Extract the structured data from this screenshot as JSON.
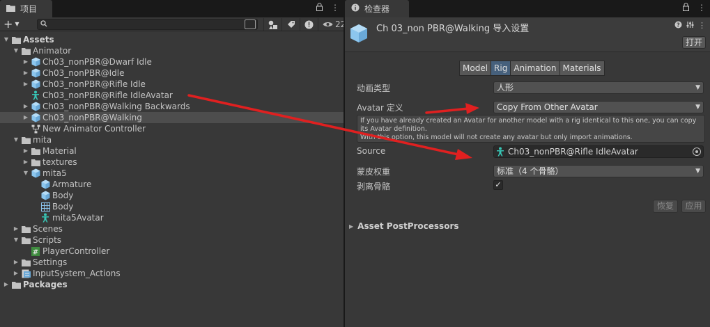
{
  "project_panel": {
    "tab_label": "项目",
    "search": {
      "value": "",
      "placeholder": ""
    },
    "visible_count": "22",
    "tree": [
      {
        "label": "Assets",
        "depth": 0,
        "arrow": "open",
        "icon": "folder",
        "bold": true
      },
      {
        "label": "Animator",
        "depth": 1,
        "arrow": "open",
        "icon": "folder"
      },
      {
        "label": "Ch03_nonPBR@Dwarf Idle",
        "depth": 2,
        "arrow": "closed",
        "icon": "model"
      },
      {
        "label": "Ch03_nonPBR@Idle",
        "depth": 2,
        "arrow": "closed",
        "icon": "model"
      },
      {
        "label": "Ch03_nonPBR@Rifle Idle",
        "depth": 2,
        "arrow": "closed",
        "icon": "model"
      },
      {
        "label": "Ch03_nonPBR@Rifle IdleAvatar",
        "depth": 2,
        "arrow": "none",
        "icon": "avatar"
      },
      {
        "label": "Ch03_nonPBR@Walking Backwards",
        "depth": 2,
        "arrow": "closed",
        "icon": "model"
      },
      {
        "label": "Ch03_nonPBR@Walking",
        "depth": 2,
        "arrow": "closed",
        "icon": "model",
        "selected": true
      },
      {
        "label": "New Animator Controller",
        "depth": 2,
        "arrow": "none",
        "icon": "controller"
      },
      {
        "label": "mita",
        "depth": 1,
        "arrow": "open",
        "icon": "folder"
      },
      {
        "label": "Material",
        "depth": 2,
        "arrow": "closed",
        "icon": "folder"
      },
      {
        "label": "textures",
        "depth": 2,
        "arrow": "closed",
        "icon": "folder"
      },
      {
        "label": "mita5",
        "depth": 2,
        "arrow": "open",
        "icon": "model"
      },
      {
        "label": "Armature",
        "depth": 3,
        "arrow": "none",
        "icon": "model"
      },
      {
        "label": "Body",
        "depth": 3,
        "arrow": "none",
        "icon": "model"
      },
      {
        "label": "Body",
        "depth": 3,
        "arrow": "none",
        "icon": "mesh"
      },
      {
        "label": "mita5Avatar",
        "depth": 3,
        "arrow": "none",
        "icon": "avatar"
      },
      {
        "label": "Scenes",
        "depth": 1,
        "arrow": "closed",
        "icon": "folder"
      },
      {
        "label": "Scripts",
        "depth": 1,
        "arrow": "open",
        "icon": "folder"
      },
      {
        "label": "PlayerController",
        "depth": 2,
        "arrow": "none",
        "icon": "script"
      },
      {
        "label": "Settings",
        "depth": 1,
        "arrow": "closed",
        "icon": "folder"
      },
      {
        "label": "InputSystem_Actions",
        "depth": 1,
        "arrow": "closed",
        "icon": "input-actions"
      },
      {
        "label": "Packages",
        "depth": 0,
        "arrow": "closed",
        "icon": "folder",
        "bold": true
      }
    ]
  },
  "inspector": {
    "tab_label": "检查器",
    "title": "Ch 03_non PBR@Walking 导入设置",
    "open_button": "打开",
    "tabs": [
      {
        "label": "Model",
        "active": false
      },
      {
        "label": "Rig",
        "active": true
      },
      {
        "label": "Animation",
        "active": false
      },
      {
        "label": "Materials",
        "active": false
      }
    ],
    "animation_type": {
      "label": "动画类型",
      "value": "人形"
    },
    "avatar_definition": {
      "label": "Avatar 定义",
      "value": "Copy From Other Avatar"
    },
    "help_text": "If you have already created an Avatar for another model with a rig identical to this one, you can copy its Avatar definition.\nWith this option, this model will not create any avatar but only import animations.",
    "source": {
      "label": "Source",
      "value": "Ch03_nonPBR@Rifle IdleAvatar"
    },
    "skin_weights": {
      "label": "蒙皮权重",
      "value": "标准（4 个骨骼）"
    },
    "strip_bones": {
      "label": "剥离骨骼",
      "checked": true
    },
    "revert_button": "恢复",
    "apply_button": "应用",
    "section": "Asset PostProcessors"
  },
  "colors": {
    "panel_bg": "#383838",
    "tab_bar_bg": "#191919",
    "selected_row": "#4d4d4d",
    "active_tab": "#46607c",
    "annotation_red": "#e02020",
    "folder": "#c2c2c2",
    "model_icon": "#8cc6ee",
    "avatar_icon": "#37c6b6"
  }
}
